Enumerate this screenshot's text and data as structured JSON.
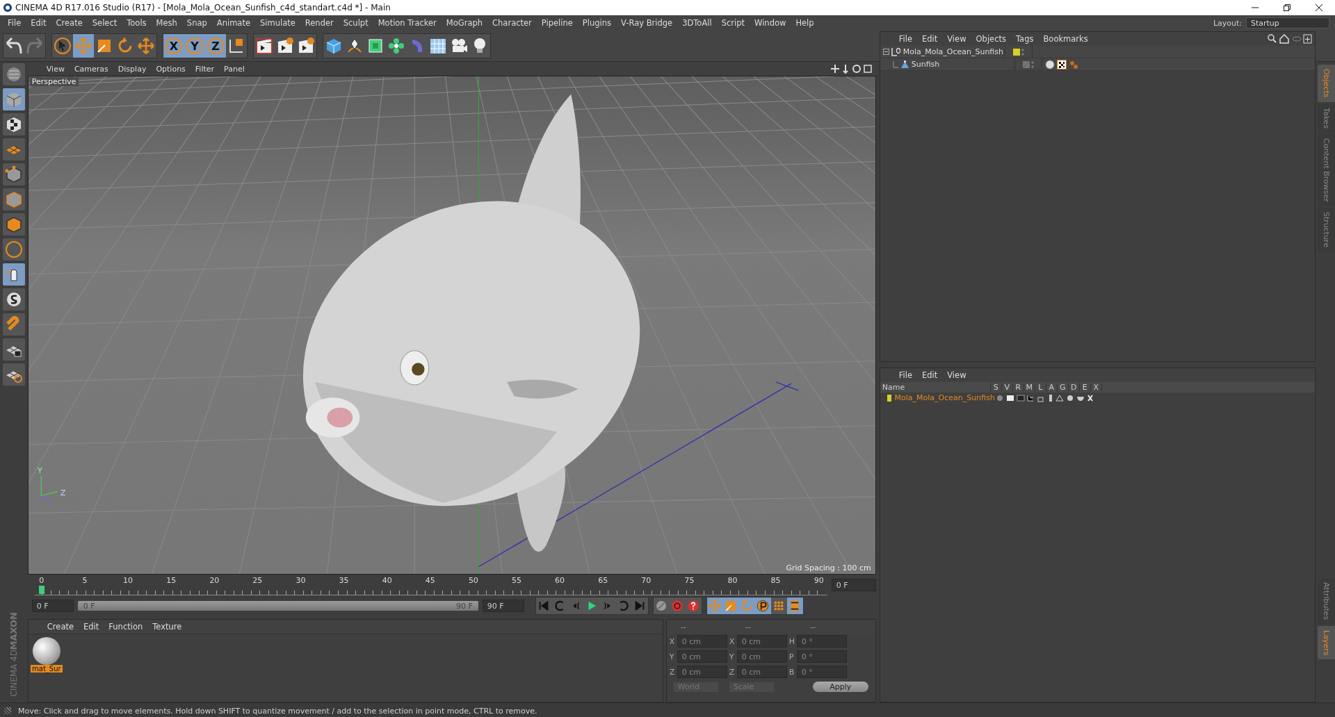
{
  "window": {
    "title": "CINEMA 4D R17.016 Studio (R17) - [Mola_Mola_Ocean_Sunfish_c4d_standart.c4d *] - Main"
  },
  "menu": [
    "File",
    "Edit",
    "Create",
    "Select",
    "Tools",
    "Mesh",
    "Snap",
    "Animate",
    "Simulate",
    "Render",
    "Sculpt",
    "Motion Tracker",
    "MoGraph",
    "Character",
    "Pipeline",
    "Plugins",
    "V-Ray Bridge",
    "3DToAll",
    "Script",
    "Window",
    "Help"
  ],
  "layout": {
    "label": "Layout:",
    "value": "Startup"
  },
  "toolbar": [
    [
      {
        "kind": "undo",
        "selected": false
      },
      {
        "kind": "redo",
        "selected": false
      }
    ],
    [
      {
        "kind": "select",
        "selected": false
      },
      {
        "kind": "move",
        "selected": true
      },
      {
        "kind": "scale",
        "selected": false
      },
      {
        "kind": "rotate",
        "selected": false
      },
      {
        "kind": "transform",
        "selected": false
      }
    ],
    [
      {
        "kind": "axis",
        "label": "X",
        "selected": true
      },
      {
        "kind": "axis",
        "label": "Y",
        "selected": true
      },
      {
        "kind": "axis",
        "label": "Z",
        "selected": true
      },
      {
        "kind": "coords",
        "selected": false
      }
    ],
    [
      {
        "kind": "render-view",
        "selected": false
      },
      {
        "kind": "render-picture",
        "selected": false
      },
      {
        "kind": "render-settings",
        "selected": false
      }
    ],
    [
      {
        "kind": "cube",
        "selected": false
      },
      {
        "kind": "pen",
        "selected": false
      },
      {
        "kind": "subdivide",
        "selected": false
      },
      {
        "kind": "cloner",
        "selected": false
      },
      {
        "kind": "deformer",
        "selected": false
      },
      {
        "kind": "floor",
        "selected": false
      },
      {
        "kind": "camera",
        "selected": false
      },
      {
        "kind": "light",
        "selected": false
      }
    ]
  ],
  "left_tools": [
    {
      "kind": "editable",
      "selected": false
    },
    {
      "kind": "model",
      "selected": true
    },
    {
      "kind": "texture",
      "selected": false
    },
    {
      "kind": "workplane",
      "selected": false
    },
    {
      "kind": "points",
      "selected": false
    },
    {
      "kind": "edges",
      "selected": false
    },
    {
      "kind": "polygons",
      "selected": false
    },
    {
      "kind": "axis",
      "selected": false
    },
    {
      "kind": "tweak",
      "selected": true
    },
    {
      "kind": "snap",
      "selected": false
    },
    {
      "kind": "magnet",
      "selected": false
    },
    {
      "kind": "lock",
      "selected": false
    },
    {
      "kind": "grid",
      "selected": false
    }
  ],
  "viewport": {
    "menu": [
      "View",
      "Cameras",
      "Display",
      "Options",
      "Filter",
      "Panel"
    ],
    "camera": "Perspective",
    "grid_spacing": "Grid Spacing : 100 cm",
    "axis_labels": [
      "Y",
      "Z"
    ]
  },
  "timeline": {
    "ticks": [
      "0",
      "5",
      "10",
      "15",
      "20",
      "25",
      "30",
      "35",
      "40",
      "45",
      "50",
      "55",
      "60",
      "65",
      "70",
      "75",
      "80",
      "85",
      "90"
    ],
    "current": "0 F"
  },
  "transport": {
    "start": "0 F",
    "range": {
      "start": "0 F",
      "end": "90 F",
      "level": 1
    },
    "end": "90 F",
    "buttons": [
      {
        "kind": "first"
      },
      {
        "kind": "prev-key"
      },
      {
        "kind": "prev-frame"
      },
      {
        "kind": "play"
      },
      {
        "kind": "next-frame"
      },
      {
        "kind": "next-key"
      },
      {
        "kind": "last"
      }
    ],
    "key_buttons": [
      {
        "kind": "record-off"
      },
      {
        "kind": "autokey"
      },
      {
        "kind": "keyset"
      }
    ],
    "track_buttons": [
      {
        "kind": "pos",
        "selected": true
      },
      {
        "kind": "scale",
        "selected": true
      },
      {
        "kind": "rot",
        "selected": true
      },
      {
        "kind": "param",
        "selected": true
      },
      {
        "kind": "pla",
        "selected": false
      },
      {
        "kind": "timeline",
        "selected": true
      }
    ]
  },
  "materials": {
    "menu": [
      "Create",
      "Edit",
      "Function",
      "Texture"
    ],
    "items": [
      {
        "name": "mat_Sur",
        "selected": true
      }
    ]
  },
  "coordinates": {
    "headers": [
      "--",
      "--",
      "--"
    ],
    "rows": [
      {
        "axis": "X",
        "position": "0 cm",
        "size_axis": "X",
        "size": "0 cm",
        "rot_axis": "H",
        "rotation": "0 °"
      },
      {
        "axis": "Y",
        "position": "0 cm",
        "size_axis": "Y",
        "size": "0 cm",
        "rot_axis": "P",
        "rotation": "0 °"
      },
      {
        "axis": "Z",
        "position": "0 cm",
        "size_axis": "Z",
        "size": "0 cm",
        "rot_axis": "B",
        "rotation": "0 °"
      }
    ],
    "space": "World",
    "mode": "Scale",
    "apply": "Apply"
  },
  "objects": {
    "menu": [
      "File",
      "Edit",
      "View",
      "Objects",
      "Tags",
      "Bookmarks"
    ],
    "tree": [
      {
        "name": "Mola_Mola_Ocean_Sunfish",
        "kind": "null",
        "color": "#d8d024",
        "expanded": true,
        "children": [
          {
            "name": "Sunfish",
            "kind": "polygon"
          }
        ]
      }
    ]
  },
  "layers": {
    "menu": [
      "File",
      "Edit",
      "View"
    ],
    "columns": [
      "Name",
      "S",
      "V",
      "R",
      "M",
      "L",
      "A",
      "G",
      "D",
      "E",
      "X"
    ],
    "rows": [
      {
        "name": "Mola_Mola_Ocean_Sunfish",
        "color": "#d8d024",
        "selected": true
      }
    ]
  },
  "side_tabs": [
    {
      "label": "Objects",
      "selected": true
    },
    {
      "label": "Takes",
      "selected": false
    },
    {
      "label": "Content Browser",
      "selected": false
    },
    {
      "label": "Structure",
      "selected": false
    }
  ],
  "side_tabs_lower": [
    {
      "label": "Attributes",
      "selected": false
    },
    {
      "label": "Layers",
      "selected": true
    }
  ],
  "logo": {
    "brand": "MAXON",
    "product": "CINEMA 4D"
  },
  "status_bar": "Move: Click and drag to move elements. Hold down SHIFT to quantize movement / add to the selection in point mode, CTRL to remove."
}
